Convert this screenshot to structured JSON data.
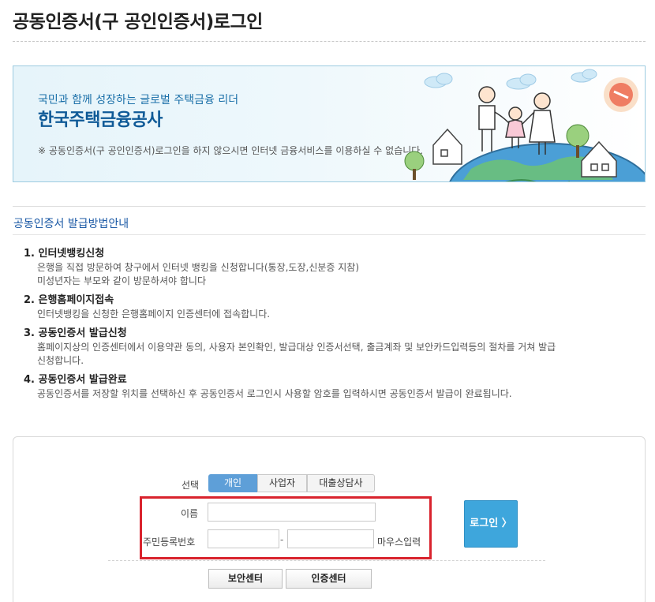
{
  "page": {
    "title": "공동인증서(구 공인인증서)로그인"
  },
  "banner": {
    "tagline": "국민과 함께 성장하는 글로벌 주택금융 리더",
    "org_name": "한국주택금융공사",
    "notice": "※ 공동인증서(구 공인인증서)로그인을 하지 않으시면 인터넷 금융서비스를 이용하실 수 없습니다."
  },
  "guide": {
    "title": "공동인증서 발급방법안내",
    "steps": [
      {
        "head": "1. 인터넷뱅킹신청",
        "lines": [
          "은행을 직접 방문하여 창구에서 인터넷 뱅킹을 신청합니다(통장,도장,신분증 지참)",
          "미성년자는 부모와 같이 방문하셔야 합니다"
        ]
      },
      {
        "head": "2. 은행홈페이지접속",
        "lines": [
          "인터넷뱅킹을 신청한 은행홈페이지 인증센터에 접속합니다."
        ]
      },
      {
        "head": "3. 공동인증서 발급신청",
        "lines": [
          "홈페이지상의 인증센터에서 이용약관 동의, 사용자 본인확인, 발급대상 인증서선택, 출금계좌 및 보안카드입력등의 절차를 거쳐 발급",
          "신청합니다."
        ]
      },
      {
        "head": "4. 공동인증서 발급완료",
        "lines": [
          "공동인증서를 저장할 위치를 선택하신 후 공동인증서 로그인시 사용할 암호를 입력하시면 공동인증서 발급이 완료됩니다."
        ]
      }
    ]
  },
  "login": {
    "select_label": "선택",
    "tabs": [
      "개인",
      "사업자",
      "대출상담사"
    ],
    "active_tab": "개인",
    "name_label": "이름",
    "name_value": "",
    "rrn_label": "주민등록번호",
    "rrn_first_value": "",
    "rrn_second_value": "",
    "rrn_separator": "-",
    "mouse_input_label": "마우스입력",
    "login_button": "로그인 〉",
    "security_center_button": "보안센터",
    "cert_center_button": "인증센터"
  },
  "colors": {
    "accent": "#5e9fd8",
    "login_button": "#3ea6dc",
    "highlight_frame": "#d9232d",
    "heading_blue": "#1c5aa6"
  }
}
